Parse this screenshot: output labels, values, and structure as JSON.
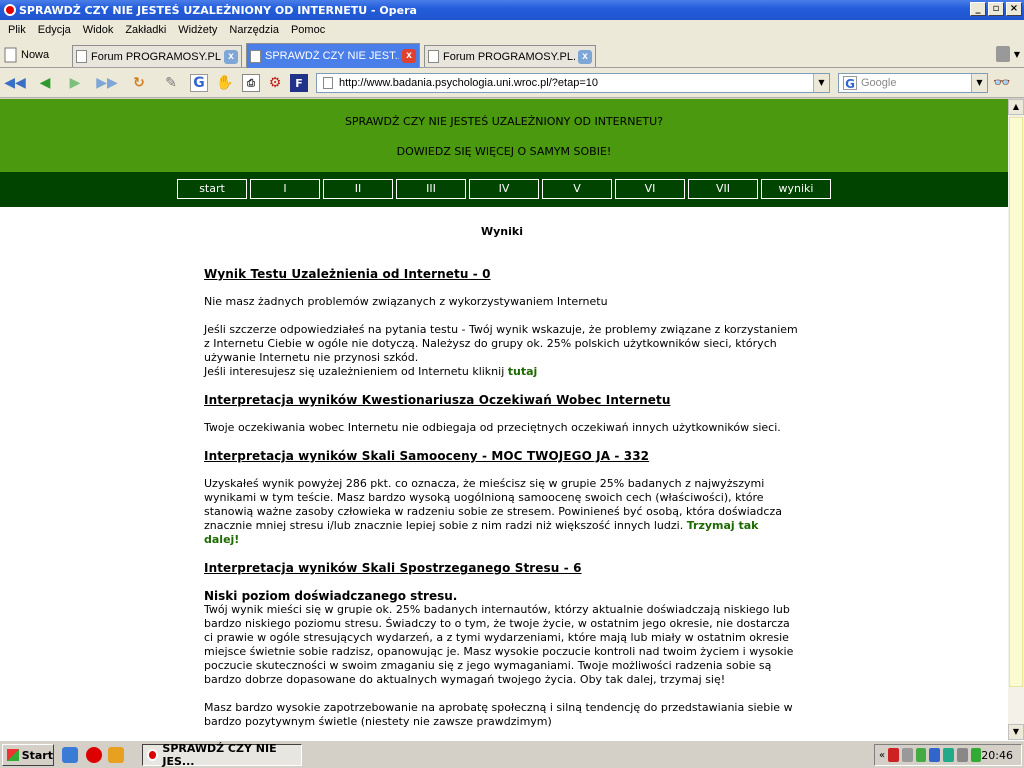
{
  "window": {
    "title": "SPRAWDŹ CZY NIE JESTEŚ UZALEŻNIONY OD INTERNETU - Opera"
  },
  "menu": [
    "Plik",
    "Edycja",
    "Widok",
    "Zakładki",
    "Widżety",
    "Narzędzia",
    "Pomoc"
  ],
  "tabs": {
    "new_tab_label": "Nowa",
    "items": [
      {
        "label": "Forum PROGRAMOSY.PL...",
        "active": false
      },
      {
        "label": "SPRAWDŹ CZY NIE JEST...",
        "active": true
      },
      {
        "label": "Forum PROGRAMOSY.PL...",
        "active": false
      }
    ]
  },
  "address": {
    "url": "http://www.badania.psychologia.uni.wroc.pl/?etap=10"
  },
  "search": {
    "placeholder": "Google"
  },
  "site": {
    "header_line1": "SPRAWDŹ CZY NIE JESTEŚ UZALEŻNIONY OD INTERNETU?",
    "header_line2": "DOWIEDZ SIĘ WIĘCEJ O SAMYM SOBIE!",
    "nav": [
      "start",
      "I",
      "II",
      "III",
      "IV",
      "V",
      "VI",
      "VII",
      "wyniki"
    ],
    "results_title": "Wyniki",
    "s1_head": "Wynik Testu Uzależnienia od Internetu - 0",
    "s1_p1": "Nie masz żadnych problemów związanych z wykorzystywaniem Internetu",
    "s1_p2": "Jeśli szczerze odpowiedziałeś na pytania testu - Twój wynik wskazuje, że problemy związane z korzystaniem z Internetu Ciebie w ogóle nie dotyczą. Należysz do grupy ok. 25% polskich użytkowników sieci, których używanie Internetu nie przynosi szkód.",
    "s1_p3": "Jeśli interesujesz się uzależnieniem od Internetu kliknij",
    "s1_link": "tutaj",
    "s2_head": "Interpretacja wyników Kwestionariusza Oczekiwań Wobec Internetu",
    "s2_p1": "Twoje oczekiwania wobec Internetu nie odbiegaja od przeciętnych oczekiwań innych użytkowników sieci.",
    "s3_head": "Interpretacja wyników Skali Samooceny - MOC TWOJEGO JA - 332",
    "s3_p1": "Uzyskałeś wynik powyżej 286 pkt. co oznacza, że mieścisz się w grupie 25% badanych z najwyższymi wynikami w tym teście. Masz bardzo wysoką uogólnioną samoocenę swoich cech (właściwości), które stanowią ważne zasoby człowieka w radzeniu sobie ze stresem. Powinieneś być osobą, która doświadcza znacznie mniej stresu i/lub znacznie lepiej sobie z nim radzi niż większość innych ludzi.",
    "s3_cheer": "Trzymaj tak dalej!",
    "s4_head": "Interpretacja wyników Skali Spostrzeganego Stresu - 6",
    "s4_sub": "Niski poziom doświadczanego stresu.",
    "s4_p1": "Twój wynik mieści się w grupie ok. 25% badanych internautów, którzy aktualnie doświadczają niskiego lub bardzo niskiego poziomu stresu. Świadczy to o tym, że twoje życie, w ostatnim jego okresie, nie dostarcza ci prawie w ogóle stresujących wydarzeń, a z tymi wydarzeniami, które mają lub miały w ostatnim okresie miejsce świetnie sobie radzisz, opanowując je. Masz wysokie poczucie kontroli nad twoim życiem i wysokie poczucie skuteczności w swoim zmaganiu się z jego wymaganiami. Twoje możliwości radzenia sobie są bardzo dobrze dopasowane do aktualnych wymagań twojego życia. Oby tak dalej, trzymaj się!",
    "s4_p2": "Masz bardzo wysokie zapotrzebowanie na aprobatę społeczną i silną tendencję do przedstawiania siebie w bardzo pozytywnym świetle (niestety nie zawsze prawdzimym)"
  },
  "taskbar": {
    "start_label": "Start",
    "task_label": "SPRAWDŹ CZY NIE JES...",
    "clock": "20:46"
  }
}
